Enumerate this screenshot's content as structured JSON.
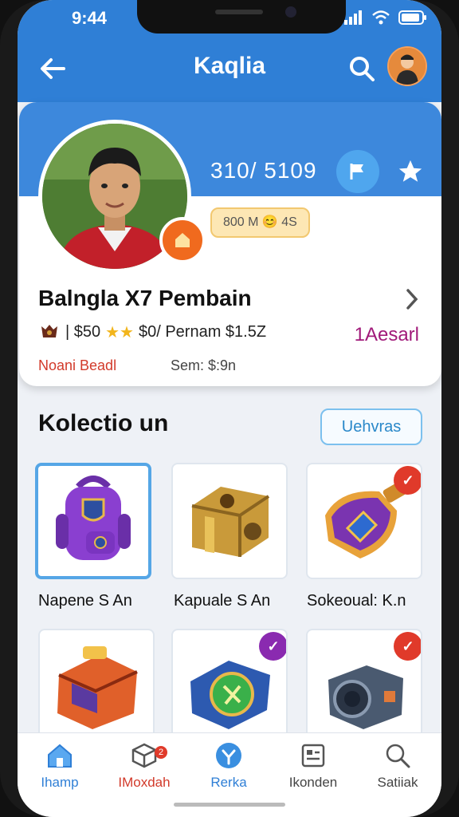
{
  "status": {
    "time": "9:44"
  },
  "app": {
    "title": "Kaqlia"
  },
  "profile": {
    "stat": "310/ 5109",
    "pill": "800 M 😊 4S",
    "name": "Balngla X7 Pembain",
    "sub_prefix": "| $50",
    "sub_rest": "$0/ Pernam $1.5Z",
    "right_link": "1Aesarl",
    "red_text": "Noani Beadl",
    "gray_text": "Sem: $:9n"
  },
  "collection": {
    "title": "Kolectio un",
    "view_label": "Uehvras",
    "items": [
      {
        "label": "Napene S An"
      },
      {
        "label": "Kapuale S An"
      },
      {
        "label": "Sokeoual: K.n"
      }
    ]
  },
  "nav": {
    "items": [
      {
        "label": "Ihamp"
      },
      {
        "label": "IMoxdah"
      },
      {
        "label": "Rerka"
      },
      {
        "label": "Ikonden"
      },
      {
        "label": "Satiiak"
      }
    ],
    "badge": "2"
  },
  "colors": {
    "primary": "#2f7fd6",
    "accent_orange": "#f06a1e",
    "link_purple": "#a11a7a",
    "alert_red": "#e03a2a"
  }
}
